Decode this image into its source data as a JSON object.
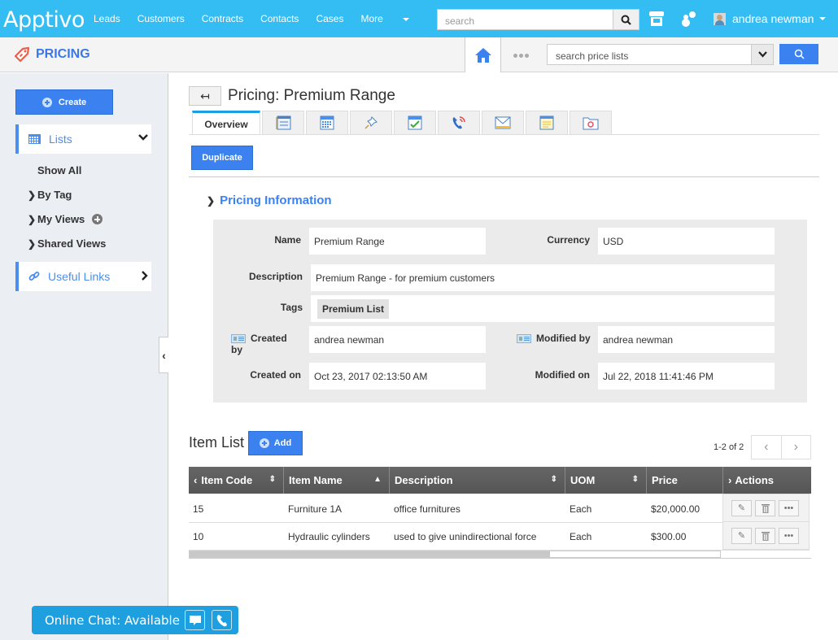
{
  "topbar": {
    "logo": "Apptivo",
    "nav": [
      "Leads",
      "Customers",
      "Contracts",
      "Contacts",
      "Cases",
      "More"
    ],
    "search_placeholder": "search",
    "user_name": "andrea newman"
  },
  "subbar": {
    "app_title": "PRICING",
    "search_placeholder": "search price lists"
  },
  "sidebar": {
    "create_label": "Create",
    "lists_label": "Lists",
    "items": [
      "Show All",
      "By Tag",
      "My Views",
      "Shared Views"
    ],
    "useful_links_label": "Useful Links"
  },
  "page": {
    "title": "Pricing: Premium Range",
    "tabs": [
      {
        "label": "Overview",
        "icon": "overview"
      },
      {
        "icon": "details-list-icon"
      },
      {
        "icon": "calendar-icon"
      },
      {
        "icon": "pin-icon"
      },
      {
        "icon": "task-check-icon"
      },
      {
        "icon": "phone-call-icon"
      },
      {
        "icon": "email-icon"
      },
      {
        "icon": "notes-icon"
      },
      {
        "icon": "attachment-folder-icon"
      }
    ],
    "duplicate_label": "Duplicate"
  },
  "pricing_info": {
    "section_title": "Pricing Information",
    "name_label": "Name",
    "name_value": "Premium Range",
    "currency_label": "Currency",
    "currency_value": "USD",
    "description_label": "Description",
    "description_value": "Premium Range - for premium customers",
    "tags_label": "Tags",
    "tag_value": "Premium List",
    "created_by_label": "Created by",
    "created_by_value": "andrea newman",
    "modified_by_label": "Modified by",
    "modified_by_value": "andrea newman",
    "created_on_label": "Created on",
    "created_on_value": "Oct 23, 2017 02:13:50 AM",
    "modified_on_label": "Modified on",
    "modified_on_value": "Jul 22, 2018 11:41:46 PM"
  },
  "item_list": {
    "title": "Item List",
    "add_label": "Add",
    "pager_text": "1-2 of 2",
    "columns": [
      "Item Code",
      "Item Name",
      "Description",
      "UOM",
      "Price",
      "Actions"
    ],
    "rows": [
      {
        "code": "15",
        "name": "Furniture 1A",
        "description": "office furnitures",
        "uom": "Each",
        "price": "$20,000.00"
      },
      {
        "code": "10",
        "name": "Hydraulic cylinders",
        "description": "used to give unindirectional force",
        "uom": "Each",
        "price": "$300.00"
      }
    ],
    "scroll_fraction": 0.68
  },
  "chat": {
    "label": "Online Chat: Available"
  },
  "colors": {
    "topbar": "#33bdf2",
    "accent": "#3b82f0",
    "sidebar_bg": "#ebeef3",
    "table_header": "#5c5c5c"
  }
}
